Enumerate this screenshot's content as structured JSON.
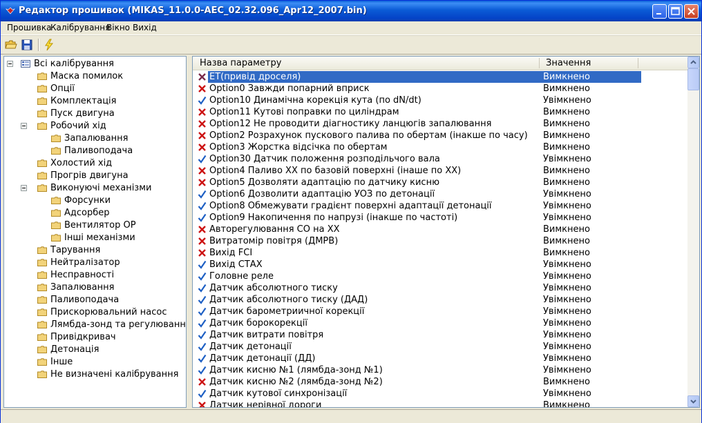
{
  "window": {
    "title": "Редактор прошивок (MIKAS_11.0.0-AEC_02.32.096_Apr12_2007.bin)"
  },
  "menu": [
    "Прошивка",
    "Калібрування",
    "Вікно",
    "Вихід"
  ],
  "toolbar": {
    "icons": [
      "open-folder-icon",
      "save-icon",
      "lightning-icon"
    ]
  },
  "tree": [
    {
      "label": "Всі калібрування",
      "level": 0,
      "expanded": true
    },
    {
      "label": "Маска помилок",
      "level": 1
    },
    {
      "label": "Опції",
      "level": 1
    },
    {
      "label": "Комплектація",
      "level": 1
    },
    {
      "label": "Пуск двигуна",
      "level": 1
    },
    {
      "label": "Робочий хід",
      "level": 1,
      "expanded": true
    },
    {
      "label": "Запалювання",
      "level": 2
    },
    {
      "label": "Паливоподача",
      "level": 2
    },
    {
      "label": "Холостий хід",
      "level": 1
    },
    {
      "label": "Прогрів двигуна",
      "level": 1
    },
    {
      "label": "Виконуючі механізми",
      "level": 1,
      "expanded": true
    },
    {
      "label": "Форсунки",
      "level": 2
    },
    {
      "label": "Адсорбер",
      "level": 2
    },
    {
      "label": "Вентилятор ОР",
      "level": 2
    },
    {
      "label": "Інші механізми",
      "level": 2
    },
    {
      "label": "Тарування",
      "level": 1
    },
    {
      "label": "Нейтралізатор",
      "level": 1
    },
    {
      "label": "Несправності",
      "level": 1
    },
    {
      "label": "Запалювання",
      "level": 1
    },
    {
      "label": "Паливоподача",
      "level": 1
    },
    {
      "label": "Прискорювальний насос",
      "level": 1
    },
    {
      "label": "Лямбда-зонд та регулювання",
      "level": 1
    },
    {
      "label": "Привідкривач",
      "level": 1
    },
    {
      "label": "Детонація",
      "level": 1
    },
    {
      "label": "Інше",
      "level": 1
    },
    {
      "label": "Не визначені калібрування",
      "level": 1
    }
  ],
  "list": {
    "columns": {
      "name": "Назва параметру",
      "value": "Значення"
    },
    "rows": [
      {
        "name": "ЕТ(привід дроселя)",
        "value": "Вимкнено",
        "state": "off",
        "selected": true
      },
      {
        "name": "Option0 Завжди попарний вприск",
        "value": "Вимкнено",
        "state": "off"
      },
      {
        "name": "Option10 Динамічна корекція кута (по dN/dt)",
        "value": "Увімкнено",
        "state": "on"
      },
      {
        "name": "Option11 Кутові поправки по циліндрам",
        "value": "Вимкнено",
        "state": "off"
      },
      {
        "name": "Option12 Не проводити діагностику ланцюгів запалювання",
        "value": "Вимкнено",
        "state": "off"
      },
      {
        "name": "Option2 Розрахунок пускового палива по обертам (інакше по часу)",
        "value": "Вимкнено",
        "state": "off"
      },
      {
        "name": "Option3 Жорстка відсічка по обертам",
        "value": "Вимкнено",
        "state": "off"
      },
      {
        "name": "Option30 Датчик положення розподільчого вала",
        "value": "Увімкнено",
        "state": "on"
      },
      {
        "name": "Option4 Паливо ХХ по базовій поверхні (інаше по ХХ)",
        "value": "Вимкнено",
        "state": "off"
      },
      {
        "name": "Option5 Дозволяти адаптацію по датчику кисню",
        "value": "Вимкнено",
        "state": "off"
      },
      {
        "name": "Option6 Дозволити адаптацію УОЗ по детонації",
        "value": "Увімкнено",
        "state": "on"
      },
      {
        "name": "Option8 Обмежувати градієнт поверхні адаптації детонації",
        "value": "Увімкнено",
        "state": "on"
      },
      {
        "name": "Option9 Накопичення по напрузі (інакше по частоті)",
        "value": "Увімкнено",
        "state": "on"
      },
      {
        "name": "Авторегулювання СО на ХХ",
        "value": "Вимкнено",
        "state": "off"
      },
      {
        "name": "Витратомір повітря (ДМРВ)",
        "value": "Вимкнено",
        "state": "off"
      },
      {
        "name": "Вихід FCI",
        "value": "Вимкнено",
        "state": "off"
      },
      {
        "name": "Вихід СТАХ",
        "value": "Увімкнено",
        "state": "on"
      },
      {
        "name": "Головне реле",
        "value": "Увімкнено",
        "state": "on"
      },
      {
        "name": "Датчик абсолютного тиску",
        "value": "Увімкнено",
        "state": "on"
      },
      {
        "name": "Датчик абсолютного тиску (ДАД)",
        "value": "Увімкнено",
        "state": "on"
      },
      {
        "name": "Датчик барометриичної корекції",
        "value": "Увімкнено",
        "state": "on"
      },
      {
        "name": "Датчик борокорекції",
        "value": "Увімкнено",
        "state": "on"
      },
      {
        "name": "Датчик витрати повітря",
        "value": "Увімкнено",
        "state": "on"
      },
      {
        "name": "Датчик детонації",
        "value": "Увімкнено",
        "state": "on"
      },
      {
        "name": "Датчик детонації (ДД)",
        "value": "Увімкнено",
        "state": "on"
      },
      {
        "name": "Датчик кисню №1 (лямбда-зонд №1)",
        "value": "Увімкнено",
        "state": "on"
      },
      {
        "name": "Датчик кисню №2 (лямбда-зонд №2)",
        "value": "Вимкнено",
        "state": "off"
      },
      {
        "name": "Датчик кутової синхронізації",
        "value": "Увімкнено",
        "state": "on"
      },
      {
        "name": "Датчик нерівної дороги",
        "value": "Вимкнено",
        "state": "off"
      }
    ]
  },
  "colors": {
    "selection": "#316ac5",
    "check": "#1d5fc4",
    "cross": "#cc1111",
    "folder": "#f2d37a"
  }
}
